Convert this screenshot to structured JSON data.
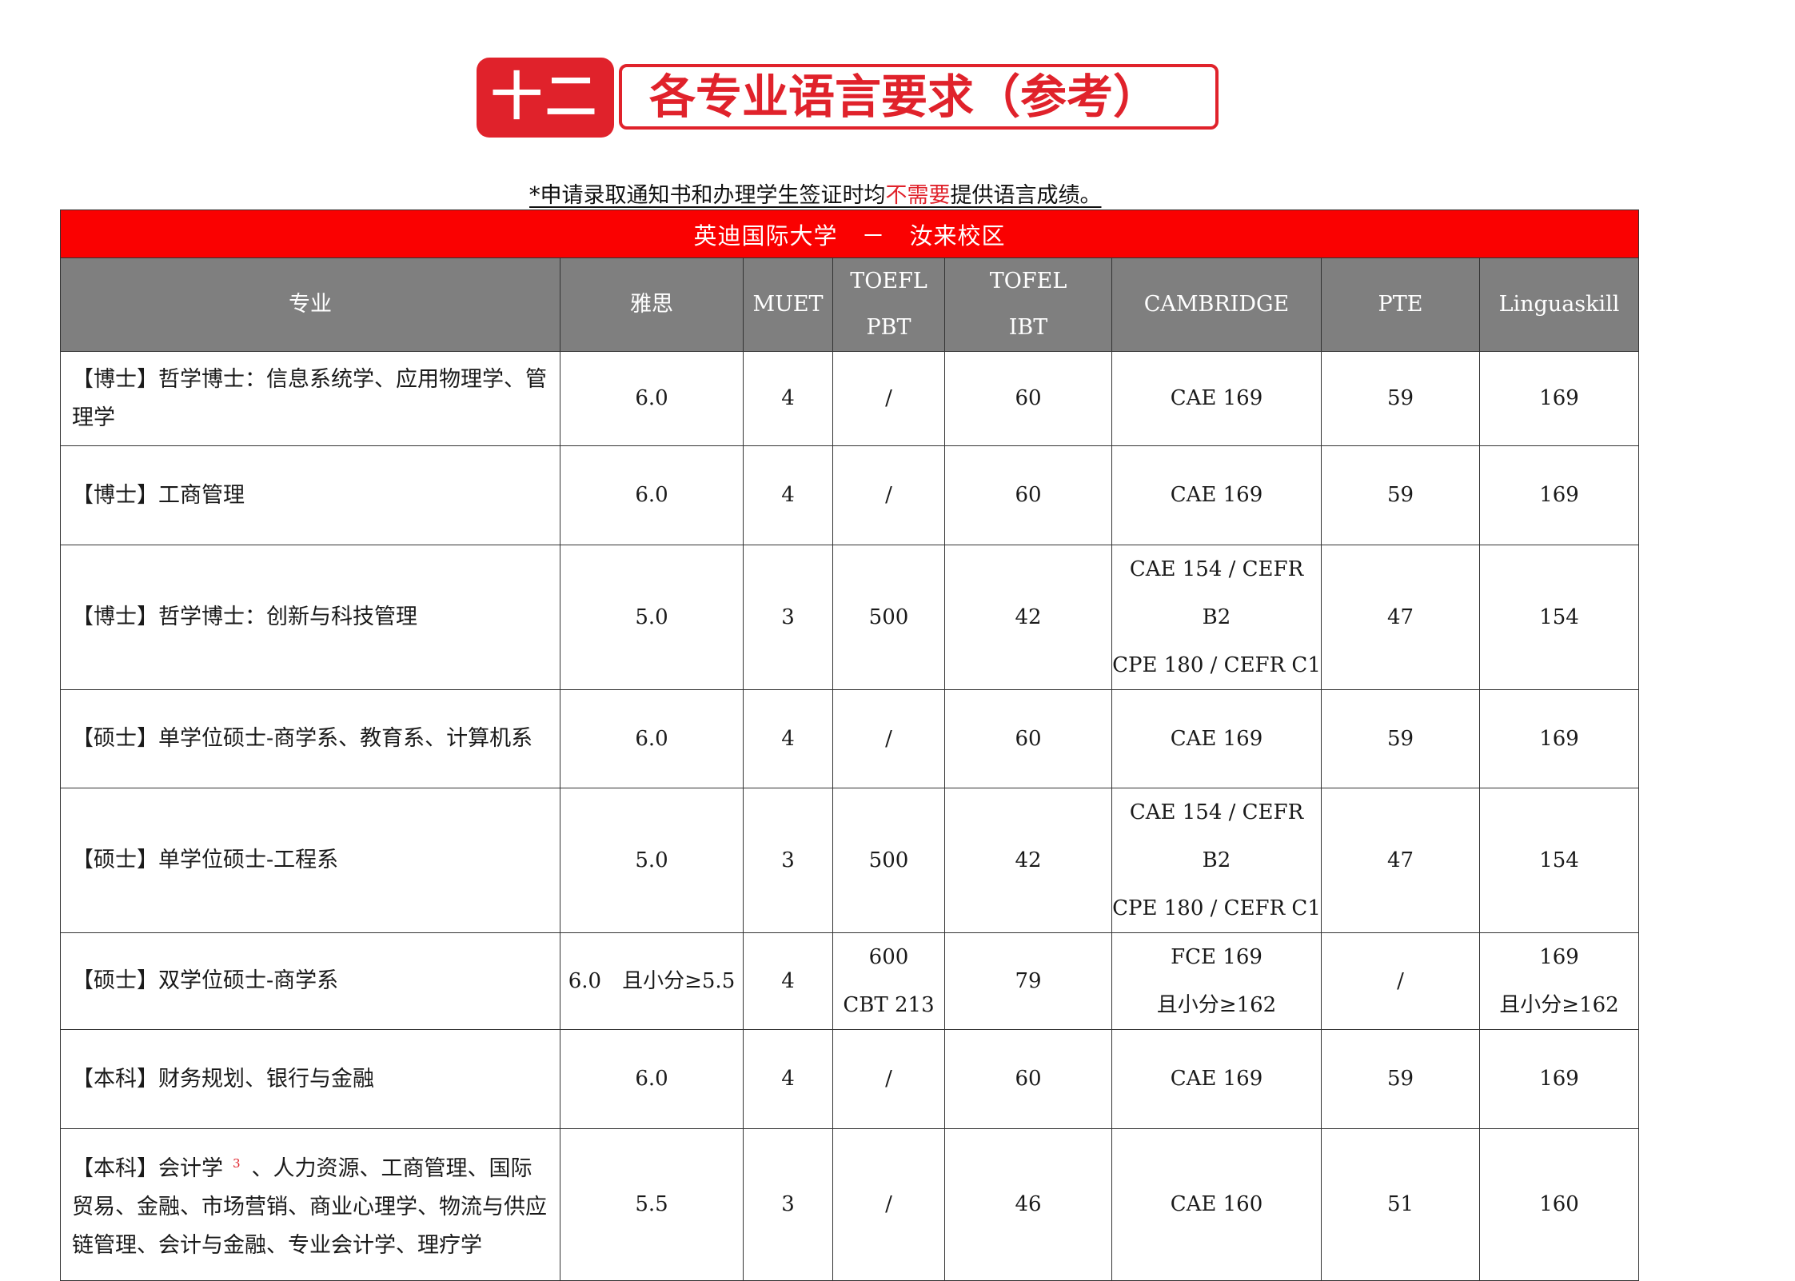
{
  "banner": {
    "number": "十二",
    "title": "各专业语言要求（参考）"
  },
  "note": {
    "prefix": "*申请录取通知书和办理学生签证时均",
    "emphasis": "不需要",
    "suffix": "提供语言成绩。"
  },
  "table": {
    "title": "英迪国际大学　－　汝来校区",
    "headers": {
      "major": "专业",
      "ielts": "雅思",
      "muet": "MUET",
      "toefl_pbt_1": "TOEFL",
      "toefl_pbt_2": "PBT",
      "toefl_ibt_1": "TOFEL",
      "toefl_ibt_2": "IBT",
      "cambridge": "CAMBRIDGE",
      "pte": "PTE",
      "linguaskill": "Linguaskill"
    },
    "rows": [
      {
        "major": "【博士】哲学博士：信息系统学、应用物理学、管理学",
        "ielts": "6.0",
        "muet": "4",
        "toefl_pbt": "/",
        "toefl_ibt": "60",
        "cambridge_1": "CAE 169",
        "cambridge_2": "",
        "pte": "59",
        "linguaskill_1": "169",
        "linguaskill_2": ""
      },
      {
        "major": "【博士】工商管理",
        "ielts": "6.0",
        "muet": "4",
        "toefl_pbt": "/",
        "toefl_ibt": "60",
        "cambridge_1": "CAE 169",
        "cambridge_2": "",
        "pte": "59",
        "linguaskill_1": "169",
        "linguaskill_2": ""
      },
      {
        "major": "【博士】哲学博士：创新与科技管理",
        "ielts": "5.0",
        "muet": "3",
        "toefl_pbt": "500",
        "toefl_ibt": "42",
        "cambridge_1": "CAE 154 / CEFR B2",
        "cambridge_2": "CPE 180 / CEFR C1",
        "pte": "47",
        "linguaskill_1": "154",
        "linguaskill_2": ""
      },
      {
        "major": "【硕士】单学位硕士-商学系、教育系、计算机系",
        "ielts": "6.0",
        "muet": "4",
        "toefl_pbt": "/",
        "toefl_ibt": "60",
        "cambridge_1": "CAE 169",
        "cambridge_2": "",
        "pte": "59",
        "linguaskill_1": "169",
        "linguaskill_2": ""
      },
      {
        "major": "【硕士】单学位硕士-工程系",
        "ielts": "5.0",
        "muet": "3",
        "toefl_pbt": "500",
        "toefl_ibt": "42",
        "cambridge_1": "CAE 154 / CEFR B2",
        "cambridge_2": "CPE 180 / CEFR C1",
        "pte": "47",
        "linguaskill_1": "154",
        "linguaskill_2": ""
      },
      {
        "major": "【硕士】双学位硕士-商学系",
        "ielts": "6.0　且小分≥5.5",
        "muet": "4",
        "toefl_pbt_1": "600",
        "toefl_pbt_2": "CBT 213",
        "toefl_ibt": "79",
        "cambridge_1": "FCE 169",
        "cambridge_2": "且小分≥162",
        "pte": "/",
        "linguaskill_1": "169",
        "linguaskill_2": "且小分≥162"
      },
      {
        "major": "【本科】财务规划、银行与金融",
        "ielts": "6.0",
        "muet": "4",
        "toefl_pbt": "/",
        "toefl_ibt": "60",
        "cambridge_1": "CAE 169",
        "cambridge_2": "",
        "pte": "59",
        "linguaskill_1": "169",
        "linguaskill_2": ""
      },
      {
        "major_a": "【本科】会计学",
        "major_sup": "3",
        "major_b": "、人力资源、工商管理、国际贸易、金融、市场营销、商业心理学、物流与供应　链管理、会计与金融、专业会计学、理疗学",
        "ielts": "5.5",
        "muet": "3",
        "toefl_pbt": "/",
        "toefl_ibt": "46",
        "cambridge_1": "CAE 160",
        "cambridge_2": "",
        "pte": "51",
        "linguaskill_1": "160",
        "linguaskill_2": ""
      }
    ]
  },
  "colors": {
    "banner_red": "#e0222b",
    "title_row_red": "#fa0101",
    "header_gray": "#7f7f7f"
  }
}
